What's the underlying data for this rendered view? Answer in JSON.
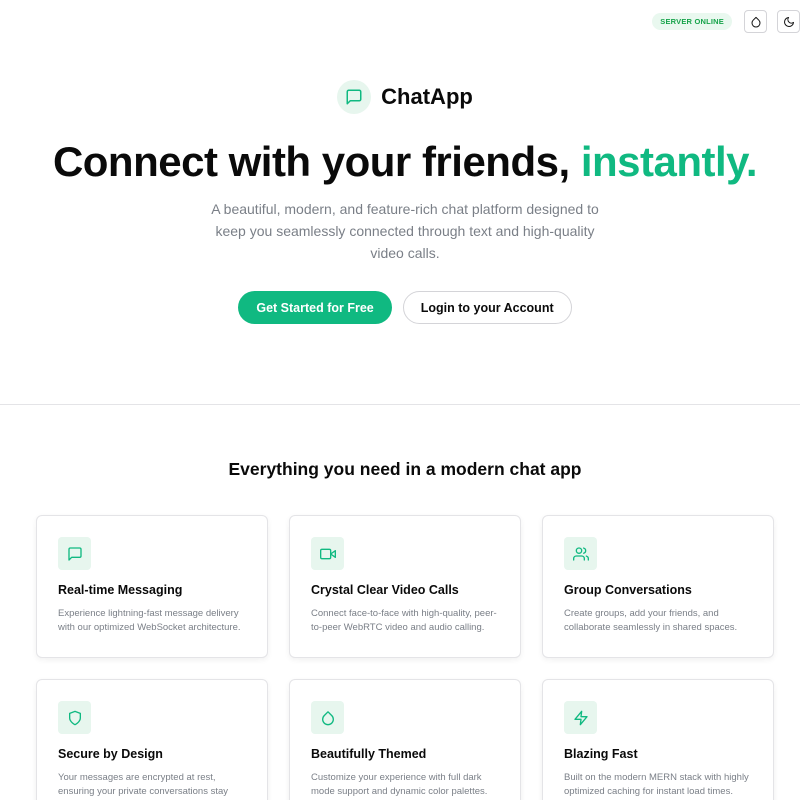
{
  "status": {
    "server_label": "SERVER ONLINE"
  },
  "topbar": {
    "theme_icon": "droplet-icon",
    "dark_mode_icon": "moon-icon"
  },
  "brand": {
    "name": "ChatApp",
    "icon": "message-square-icon"
  },
  "hero": {
    "headline_main": "Connect with your friends, ",
    "headline_accent": "instantly.",
    "subtitle": "A beautiful, modern, and feature-rich chat platform designed to keep you seamlessly connected through text and high-quality video calls.",
    "primary_cta": "Get Started for Free",
    "secondary_cta": "Login to your Account"
  },
  "features": {
    "title": "Everything you need in a modern chat app",
    "items": [
      {
        "icon": "message-square-icon",
        "title": "Real-time Messaging",
        "description": "Experience lightning-fast message delivery with our optimized WebSocket architecture."
      },
      {
        "icon": "video-icon",
        "title": "Crystal Clear Video Calls",
        "description": "Connect face-to-face with high-quality, peer-to-peer WebRTC video and audio calling."
      },
      {
        "icon": "users-icon",
        "title": "Group Conversations",
        "description": "Create groups, add your friends, and collaborate seamlessly in shared spaces."
      },
      {
        "icon": "shield-icon",
        "title": "Secure by Design",
        "description": "Your messages are encrypted at rest, ensuring your private conversations stay"
      },
      {
        "icon": "droplet-icon",
        "title": "Beautifully Themed",
        "description": "Customize your experience with full dark mode support and dynamic color palettes."
      },
      {
        "icon": "zap-icon",
        "title": "Blazing Fast",
        "description": "Built on the modern MERN stack with highly optimized caching for instant load times."
      }
    ]
  },
  "colors": {
    "accent": "#10b981",
    "accent_soft": "#e7f6ee",
    "status_green": "#16a34a",
    "muted_text": "#7a7f87"
  }
}
